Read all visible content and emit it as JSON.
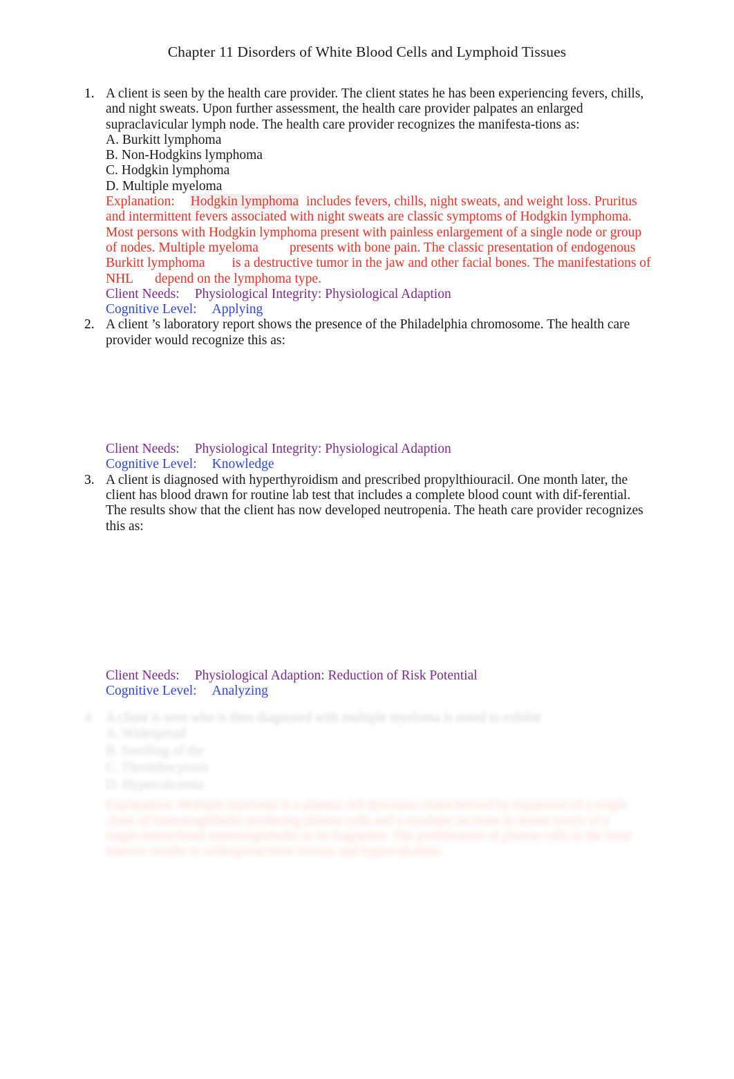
{
  "document": {
    "title": "Chapter 11 Disorders of White Blood Cells and Lymphoid Tissues"
  },
  "labels": {
    "client_needs": "Client Needs:",
    "cognitive_level": "Cognitive Level:",
    "explanation": "Explanation:"
  },
  "questions": [
    {
      "number": "1.",
      "stem": "A client is seen by the health care provider. The client states he has been experiencing fevers, chills, and night sweats. Upon further assessment, the health care provider palpates an enlarged supraclavicular lymph node. The health care provider recognizes the manifesta-tions as:",
      "options": [
        "A. Burkitt lymphoma",
        "B. Non-Hodgkins lymphoma",
        "C. Hodgkin lymphoma",
        "D. Multiple myeloma"
      ],
      "explanation": {
        "seg1_highlight": "Hodgkin lymphoma",
        "seg2": "includes fevers, chills, night sweats, and weight loss. Pruritus and intermittent fevers associated with night sweats are classic symptoms of Hodgkin lymphoma. Most persons with Hodgkin lymphoma present with painless enlargement of a single node or group of nodes. Multiple myeloma",
        "seg3": "presents with bone pain. The classic presentation of endogenous Burkitt lymphoma",
        "seg4": "is a destructive tumor in the jaw and other facial bones. The manifestations of NHL",
        "seg5": "depend on the lymphoma type."
      },
      "client_needs": "Physiological Integrity: Physiological Adaption",
      "cognitive_level": "Applying"
    },
    {
      "number": "2.",
      "stem": "A client ’s laboratory report shows the presence of the Philadelphia chromosome. The health care provider would recognize this as:",
      "options": [],
      "client_needs": "Physiological Integrity: Physiological Adaption",
      "cognitive_level": "Knowledge"
    },
    {
      "number": "3.",
      "stem": "A client is diagnosed with hyperthyroidism and prescribed propylthiouracil. One month later, the client has blood drawn for routine lab test that includes a complete blood count with dif-ferential. The results show that the client has now developed neutropenia. The heath care provider recognizes this as:",
      "options": [],
      "client_needs": "Physiological Adaption: Reduction of Risk Potential",
      "cognitive_level": "Analyzing"
    }
  ],
  "obscured_question": {
    "number": "4.",
    "stem": "A client is seen who is then diagnosed with multiple myeloma is noted to exhibit",
    "options": [
      "A. Widespread",
      "B. Swelling of the",
      "C. Thrombocytosis",
      "D. Hypercalcemia"
    ],
    "explanation": "Explanation: Multiple myeloma is a plasma cell dyscrasia characterized by expansion of a single clone of immunoglobulin producing plasma cells and a resultant increase in serum levels of a single monoclonal immunoglobulin or its fragments. The proliferation of plasma cells in the bone marrow results in widespread bone lesions and hypercalcemia."
  },
  "colors": {
    "explanation_red": "#ee3124",
    "client_needs_purple": "#7b2a8e",
    "cognitive_level_blue": "#2d46e8",
    "highlight_gray": "#f0eeee",
    "body_text": "#1a1a1a",
    "page_background": "#ffffff"
  }
}
